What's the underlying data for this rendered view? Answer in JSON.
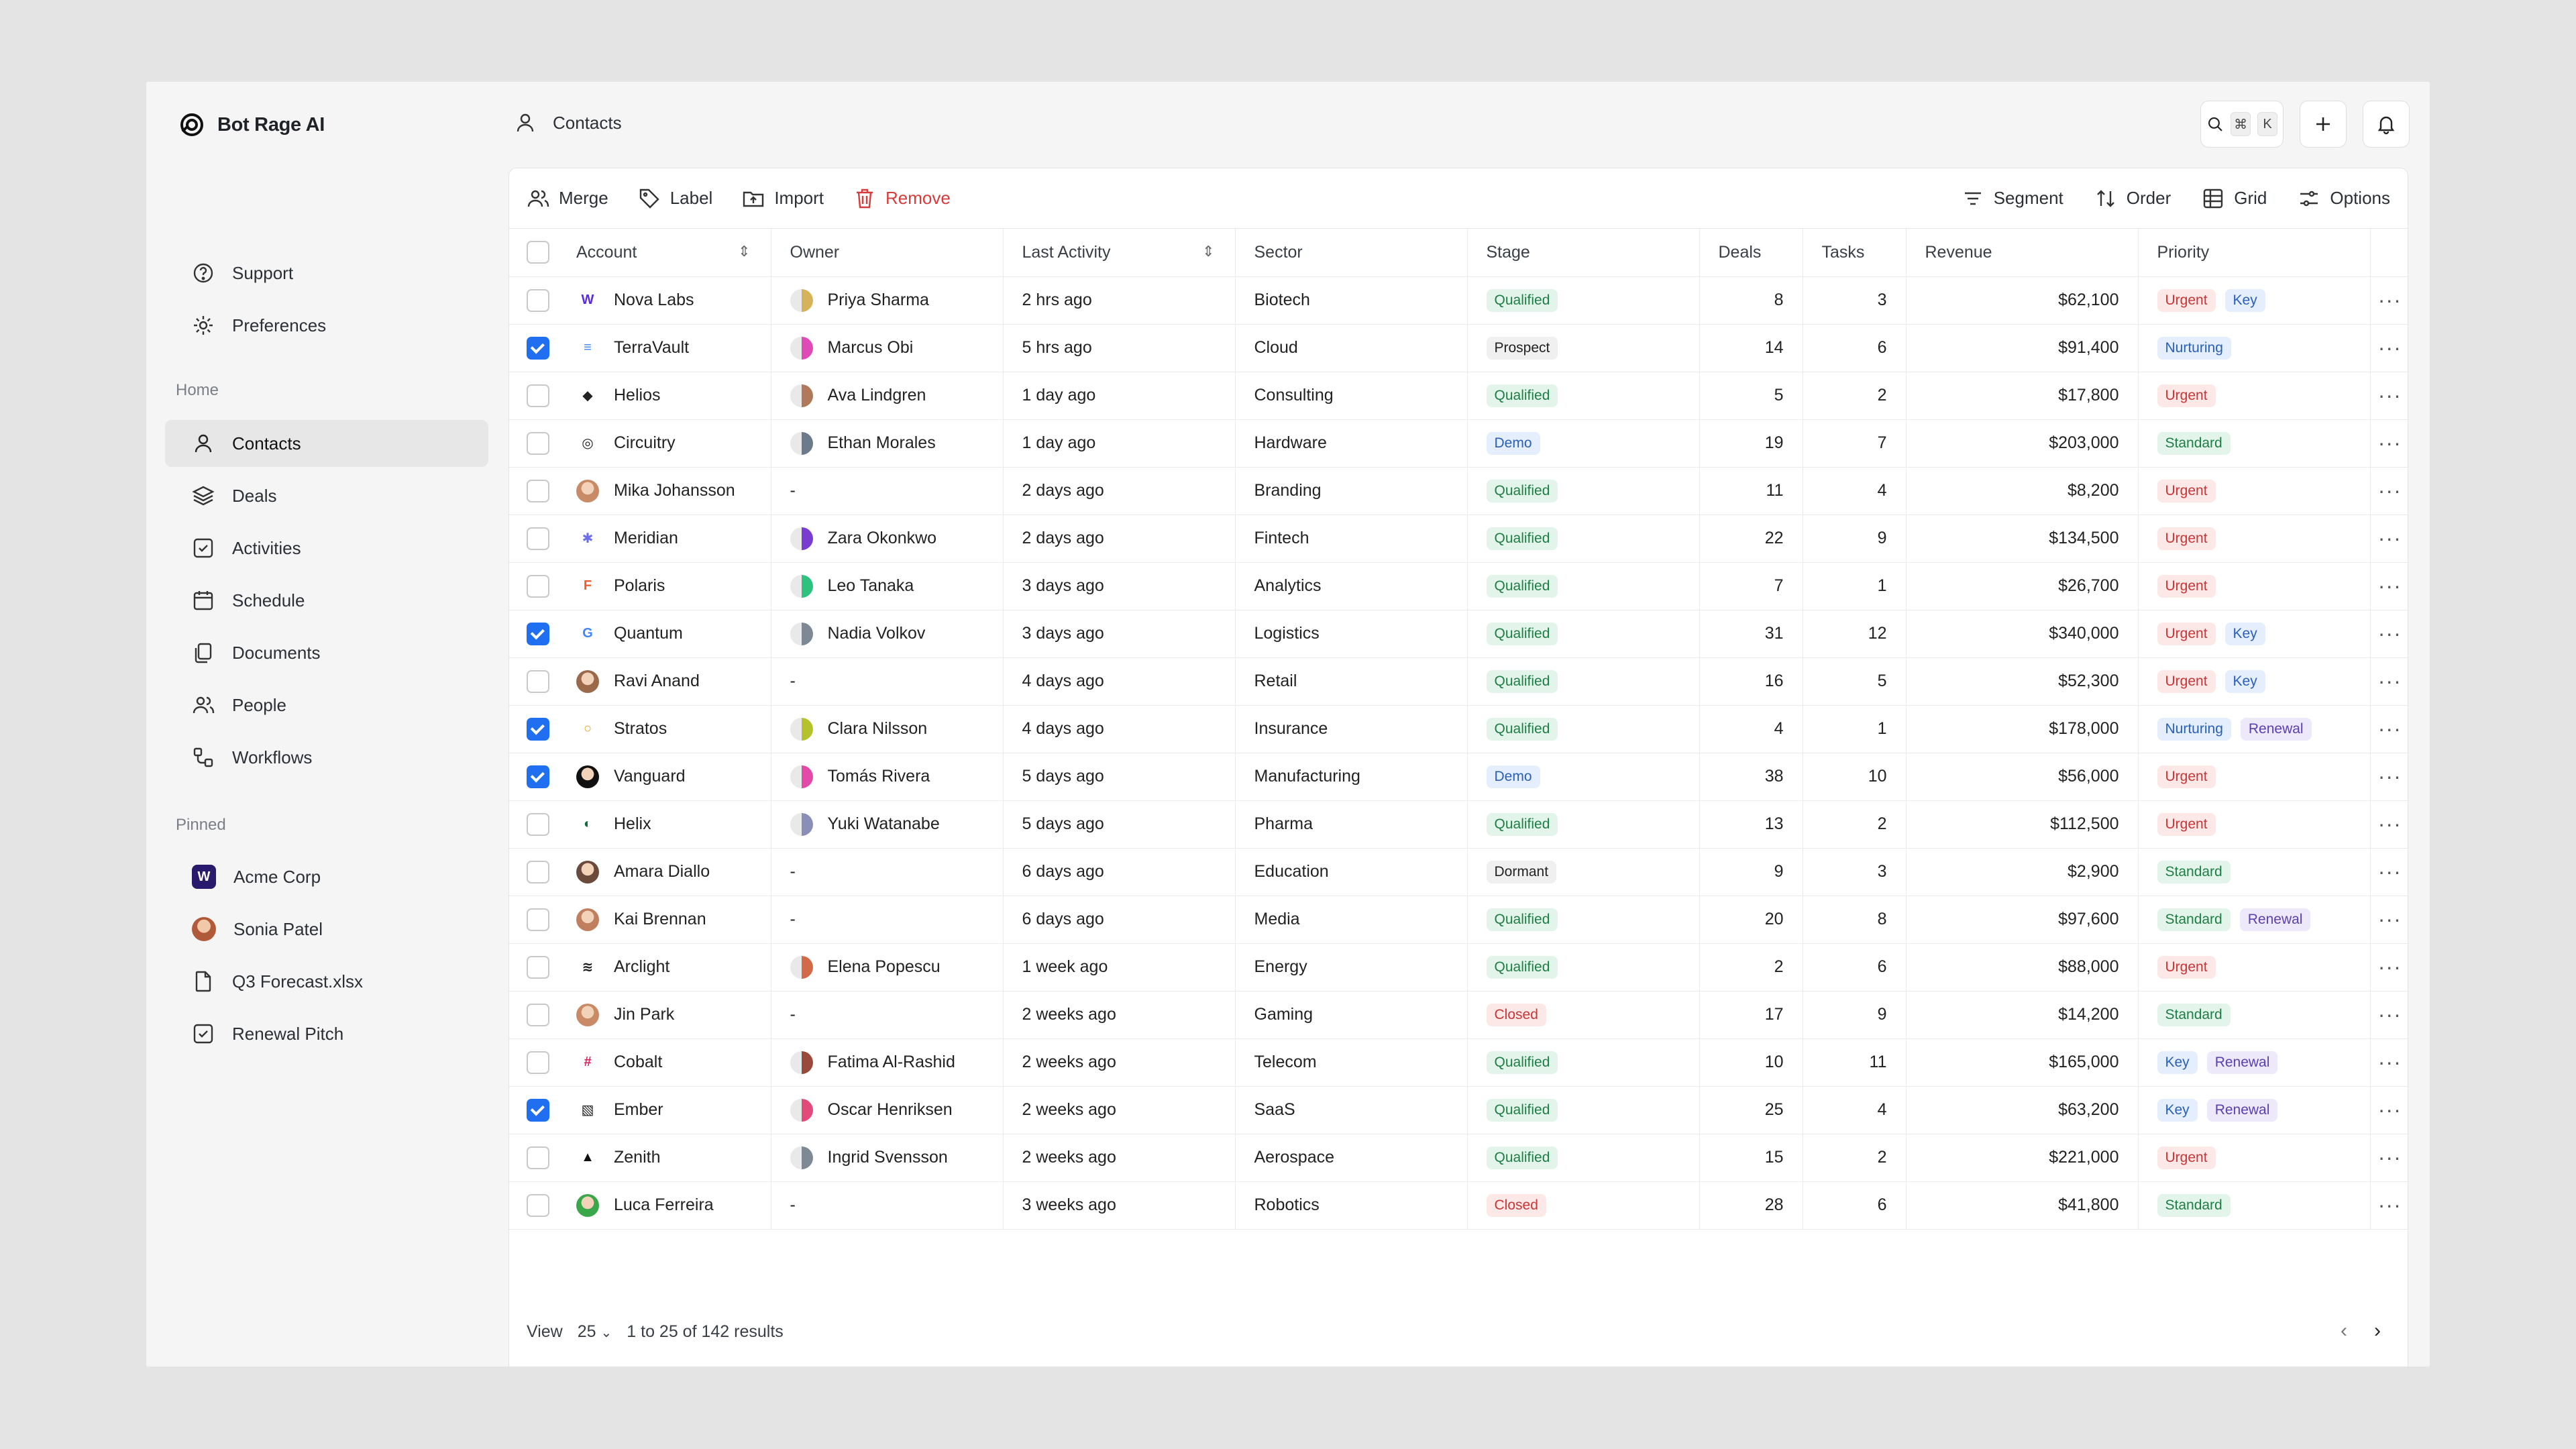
{
  "app": {
    "name": "Bot Rage AI"
  },
  "sidebar": {
    "top_items": [
      {
        "label": "Support",
        "icon": "help-circle-icon"
      },
      {
        "label": "Preferences",
        "icon": "gear-icon"
      }
    ],
    "home_label": "Home",
    "home_items": [
      {
        "label": "Contacts",
        "icon": "user-icon",
        "active": true
      },
      {
        "label": "Deals",
        "icon": "layers-icon"
      },
      {
        "label": "Activities",
        "icon": "check-square-icon"
      },
      {
        "label": "Schedule",
        "icon": "calendar-icon"
      },
      {
        "label": "Documents",
        "icon": "documents-icon"
      },
      {
        "label": "People",
        "icon": "users-icon"
      },
      {
        "label": "Workflows",
        "icon": "workflow-icon"
      }
    ],
    "pinned_label": "Pinned",
    "pinned_items": [
      {
        "label": "Acme Corp",
        "icon": "company-logo"
      },
      {
        "label": "Sonia Patel",
        "icon": "person-avatar"
      },
      {
        "label": "Q3 Forecast.xlsx",
        "icon": "file-icon"
      },
      {
        "label": "Renewal Pitch",
        "icon": "check-square-icon"
      }
    ]
  },
  "header": {
    "title": "Contacts",
    "search_kbd_1": "⌘",
    "search_kbd_2": "K"
  },
  "toolbar": {
    "merge": "Merge",
    "label": "Label",
    "import": "Import",
    "remove": "Remove",
    "segment": "Segment",
    "order": "Order",
    "grid": "Grid",
    "options": "Options"
  },
  "colors": {
    "accent": "#1f6ff0",
    "danger": "#d63c3c",
    "qualified": "#1e7d45",
    "demo": "#2a5fb8",
    "renewal": "#5b3fb0"
  },
  "table": {
    "columns": {
      "account": "Account",
      "owner": "Owner",
      "last_activity": "Last Activity",
      "sector": "Sector",
      "stage": "Stage",
      "deals": "Deals",
      "tasks": "Tasks",
      "revenue": "Revenue",
      "priority": "Priority"
    },
    "rows": [
      {
        "checked": false,
        "account": "Nova Labs",
        "logo": "#5a2ae0",
        "logo_text": "W",
        "owner": "Priya Sharma",
        "owner_color": "#d6b25a",
        "last_activity": "2 hrs ago",
        "sector": "Biotech",
        "stage": "Qualified",
        "deals": "8",
        "tasks": "3",
        "revenue": "$62,100",
        "priority": [
          "Urgent",
          "Key"
        ]
      },
      {
        "checked": true,
        "account": "TerraVault",
        "logo": "#3b82f6",
        "logo_text": "≡",
        "owner": "Marcus Obi",
        "owner_color": "#e04ab6",
        "last_activity": "5 hrs ago",
        "sector": "Cloud",
        "stage": "Prospect",
        "deals": "14",
        "tasks": "6",
        "revenue": "$91,400",
        "priority": [
          "Nurturing"
        ]
      },
      {
        "checked": false,
        "account": "Helios",
        "logo": "#222222",
        "logo_text": "◆",
        "owner": "Ava Lindgren",
        "owner_color": "#b07a5a",
        "last_activity": "1 day ago",
        "sector": "Consulting",
        "stage": "Qualified",
        "deals": "5",
        "tasks": "2",
        "revenue": "$17,800",
        "priority": [
          "Urgent"
        ]
      },
      {
        "checked": false,
        "account": "Circuitry",
        "logo": "#222222",
        "logo_text": "◎",
        "owner": "Ethan Morales",
        "owner_color": "#6b7b8c",
        "last_activity": "1 day ago",
        "sector": "Hardware",
        "stage": "Demo",
        "deals": "19",
        "tasks": "7",
        "revenue": "$203,000",
        "priority": [
          "Standard"
        ]
      },
      {
        "checked": false,
        "account": "Mika Johansson",
        "logo": "#c98a66",
        "logo_text": "",
        "owner": "-",
        "owner_color": "",
        "last_activity": "2 days ago",
        "sector": "Branding",
        "stage": "Qualified",
        "deals": "11",
        "tasks": "4",
        "revenue": "$8,200",
        "priority": [
          "Urgent"
        ]
      },
      {
        "checked": false,
        "account": "Meridian",
        "logo": "#6b6cf0",
        "logo_text": "✱",
        "owner": "Zara Okonkwo",
        "owner_color": "#7a3bd0",
        "last_activity": "2 days ago",
        "sector": "Fintech",
        "stage": "Qualified",
        "deals": "22",
        "tasks": "9",
        "revenue": "$134,500",
        "priority": [
          "Urgent"
        ]
      },
      {
        "checked": false,
        "account": "Polaris",
        "logo": "#f25a2a",
        "logo_text": "F",
        "owner": "Leo Tanaka",
        "owner_color": "#2ec27e",
        "last_activity": "3 days ago",
        "sector": "Analytics",
        "stage": "Qualified",
        "deals": "7",
        "tasks": "1",
        "revenue": "$26,700",
        "priority": [
          "Urgent"
        ]
      },
      {
        "checked": true,
        "account": "Quantum",
        "logo": "#4285f4",
        "logo_text": "G",
        "owner": "Nadia Volkov",
        "owner_color": "#7d8a96",
        "last_activity": "3 days ago",
        "sector": "Logistics",
        "stage": "Qualified",
        "deals": "31",
        "tasks": "12",
        "revenue": "$340,000",
        "priority": [
          "Urgent",
          "Key"
        ]
      },
      {
        "checked": false,
        "account": "Ravi Anand",
        "logo": "#9a6a4a",
        "logo_text": "",
        "owner": "-",
        "owner_color": "",
        "last_activity": "4 days ago",
        "sector": "Retail",
        "stage": "Qualified",
        "deals": "16",
        "tasks": "5",
        "revenue": "$52,300",
        "priority": [
          "Urgent",
          "Key"
        ]
      },
      {
        "checked": true,
        "account": "Stratos",
        "logo": "#e8a020",
        "logo_text": "○",
        "owner": "Clara Nilsson",
        "owner_color": "#b5c22e",
        "last_activity": "4 days ago",
        "sector": "Insurance",
        "stage": "Qualified",
        "deals": "4",
        "tasks": "1",
        "revenue": "$178,000",
        "priority": [
          "Nurturing",
          "Renewal"
        ]
      },
      {
        "checked": true,
        "account": "Vanguard",
        "logo": "#111111",
        "logo_text": "",
        "owner": "Tomás Rivera",
        "owner_color": "#e34aa8",
        "last_activity": "5 days ago",
        "sector": "Manufacturing",
        "stage": "Demo",
        "deals": "38",
        "tasks": "10",
        "revenue": "$56,000",
        "priority": [
          "Urgent"
        ]
      },
      {
        "checked": false,
        "account": "Helix",
        "logo": "#0f6b3e",
        "logo_text": "◐",
        "owner": "Yuki Watanabe",
        "owner_color": "#8a8fb8",
        "last_activity": "5 days ago",
        "sector": "Pharma",
        "stage": "Qualified",
        "deals": "13",
        "tasks": "2",
        "revenue": "$112,500",
        "priority": [
          "Urgent"
        ]
      },
      {
        "checked": false,
        "account": "Amara Diallo",
        "logo": "#6a4a3a",
        "logo_text": "",
        "owner": "-",
        "owner_color": "",
        "last_activity": "6 days ago",
        "sector": "Education",
        "stage": "Dormant",
        "deals": "9",
        "tasks": "3",
        "revenue": "$2,900",
        "priority": [
          "Standard"
        ]
      },
      {
        "checked": false,
        "account": "Kai Brennan",
        "logo": "#c08060",
        "logo_text": "",
        "owner": "-",
        "owner_color": "",
        "last_activity": "6 days ago",
        "sector": "Media",
        "stage": "Qualified",
        "deals": "20",
        "tasks": "8",
        "revenue": "$97,600",
        "priority": [
          "Standard",
          "Renewal"
        ]
      },
      {
        "checked": false,
        "account": "Arclight",
        "logo": "#1b1b1b",
        "logo_text": "≋",
        "owner": "Elena Popescu",
        "owner_color": "#d26a4a",
        "last_activity": "1 week ago",
        "sector": "Energy",
        "stage": "Qualified",
        "deals": "2",
        "tasks": "6",
        "revenue": "$88,000",
        "priority": [
          "Urgent"
        ]
      },
      {
        "checked": false,
        "account": "Jin Park",
        "logo": "#c98a66",
        "logo_text": "",
        "owner": "-",
        "owner_color": "",
        "last_activity": "2 weeks ago",
        "sector": "Gaming",
        "stage": "Closed",
        "deals": "17",
        "tasks": "9",
        "revenue": "$14,200",
        "priority": [
          "Standard"
        ]
      },
      {
        "checked": false,
        "account": "Cobalt",
        "logo": "#e01e5a",
        "logo_text": "#",
        "owner": "Fatima Al-Rashid",
        "owner_color": "#9a4a3a",
        "last_activity": "2 weeks ago",
        "sector": "Telecom",
        "stage": "Qualified",
        "deals": "10",
        "tasks": "11",
        "revenue": "$165,000",
        "priority": [
          "Key",
          "Renewal"
        ]
      },
      {
        "checked": true,
        "account": "Ember",
        "logo": "#222222",
        "logo_text": "▧",
        "owner": "Oscar Henriksen",
        "owner_color": "#e34a7a",
        "last_activity": "2 weeks ago",
        "sector": "SaaS",
        "stage": "Qualified",
        "deals": "25",
        "tasks": "4",
        "revenue": "$63,200",
        "priority": [
          "Key",
          "Renewal"
        ]
      },
      {
        "checked": false,
        "account": "Zenith",
        "logo": "#111111",
        "logo_text": "▲",
        "owner": "Ingrid Svensson",
        "owner_color": "#7d8a96",
        "last_activity": "2 weeks ago",
        "sector": "Aerospace",
        "stage": "Qualified",
        "deals": "15",
        "tasks": "2",
        "revenue": "$221,000",
        "priority": [
          "Urgent"
        ]
      },
      {
        "checked": false,
        "account": "Luca Ferreira",
        "logo": "#3aa84a",
        "logo_text": "",
        "owner": "-",
        "owner_color": "",
        "last_activity": "3 weeks ago",
        "sector": "Robotics",
        "stage": "Closed",
        "deals": "28",
        "tasks": "6",
        "revenue": "$41,800",
        "priority": [
          "Standard"
        ]
      }
    ]
  },
  "footer": {
    "view_label": "View",
    "page_size": "25",
    "results": "1 to 25 of 142 results"
  }
}
